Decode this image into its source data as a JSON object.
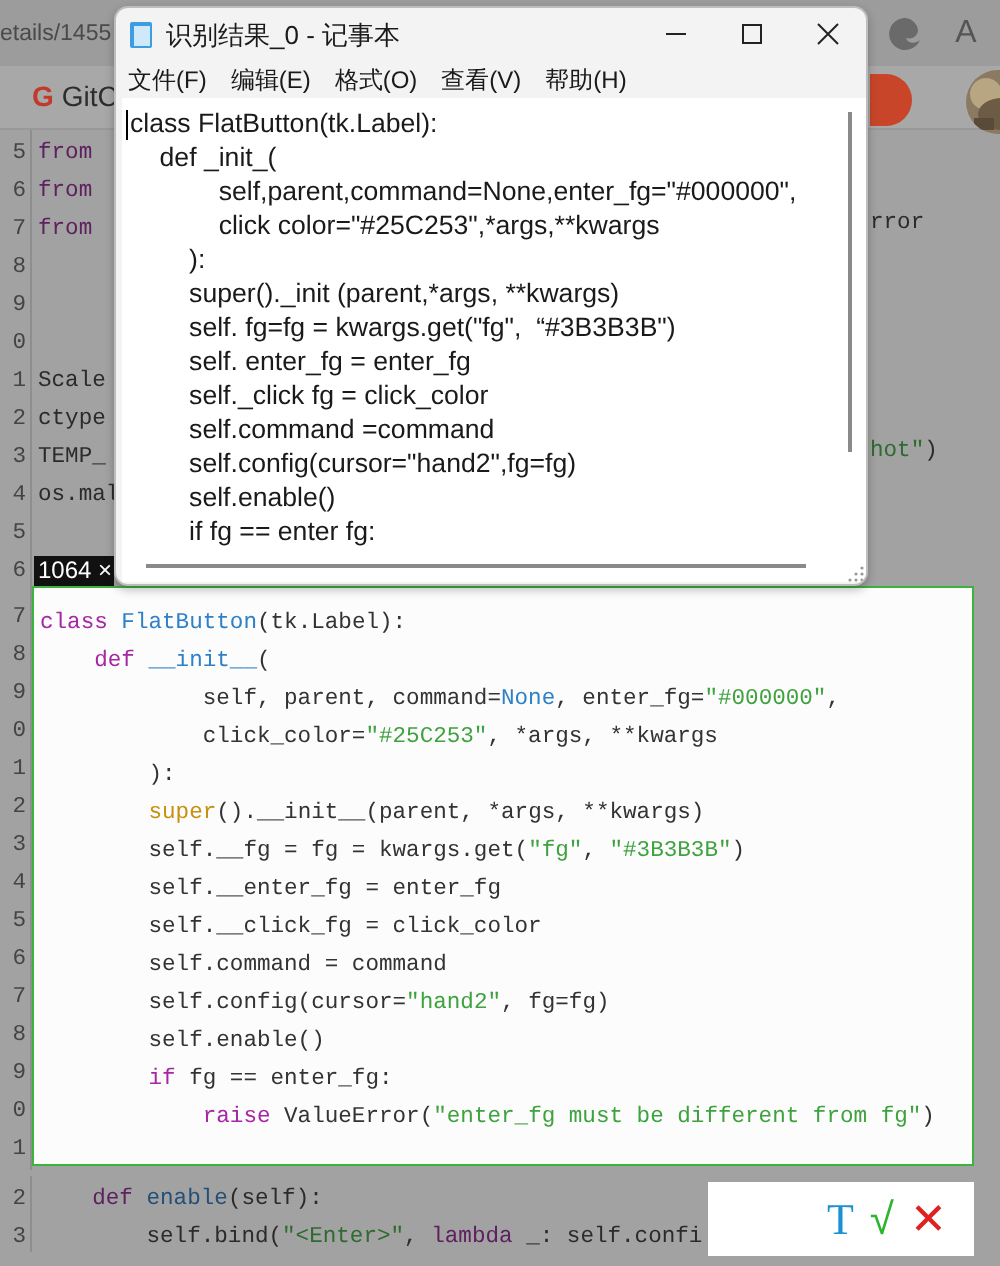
{
  "browser": {
    "address_fragment": "etails/1455",
    "read_aloud_glyph": "A",
    "bookmark": {
      "logo": "G",
      "label": "GitC"
    }
  },
  "editor": {
    "lines": [
      {
        "number": "5",
        "tokens": [
          {
            "kind": "keyword",
            "text": "from"
          }
        ]
      },
      {
        "number": "6",
        "tokens": [
          {
            "kind": "keyword",
            "text": "from"
          }
        ]
      },
      {
        "number": "7",
        "tokens": [
          {
            "kind": "keyword",
            "text": "from"
          }
        ],
        "right": [
          {
            "kind": "plain",
            "text": "rror"
          }
        ]
      },
      {
        "number": "8"
      },
      {
        "number": "9"
      },
      {
        "number": "0"
      },
      {
        "number": "1",
        "tokens": [
          {
            "kind": "plain",
            "text": "Scale"
          }
        ]
      },
      {
        "number": "2",
        "tokens": [
          {
            "kind": "plain",
            "text": "ctype"
          }
        ]
      },
      {
        "number": "3",
        "tokens": [
          {
            "kind": "plain",
            "text": "TEMP_"
          }
        ],
        "right": [
          {
            "kind": "string",
            "text": "hot\""
          },
          {
            "kind": "plain",
            "text": ")"
          }
        ]
      },
      {
        "number": "4",
        "tokens": [
          {
            "kind": "plain",
            "text": "os.mal"
          }
        ]
      },
      {
        "number": "5"
      },
      {
        "number": "6"
      }
    ]
  },
  "selection": {
    "size_label": "1064 ×",
    "lines": [
      {
        "number": "7",
        "tokens": [
          {
            "kind": "keyword",
            "text": "class"
          },
          {
            "kind": "name",
            "text": " FlatButton"
          },
          {
            "kind": "plain",
            "text": "(tk.Label):"
          }
        ]
      },
      {
        "number": "8",
        "tokens": [
          {
            "kind": "keyword",
            "text": "    def"
          },
          {
            "kind": "name",
            "text": " __init__"
          },
          {
            "kind": "plain",
            "text": "("
          }
        ]
      },
      {
        "number": "9",
        "tokens": [
          {
            "kind": "plain",
            "text": "            self, parent, command="
          },
          {
            "kind": "name",
            "text": "None"
          },
          {
            "kind": "plain",
            "text": ", enter_fg="
          },
          {
            "kind": "string",
            "text": "\"#000000\""
          },
          {
            "kind": "plain",
            "text": ","
          }
        ]
      },
      {
        "number": "0",
        "tokens": [
          {
            "kind": "plain",
            "text": "            click_color="
          },
          {
            "kind": "string",
            "text": "\"#25C253\""
          },
          {
            "kind": "plain",
            "text": ", *args, **kwargs"
          }
        ]
      },
      {
        "number": "1",
        "tokens": [
          {
            "kind": "plain",
            "text": "        ):"
          }
        ]
      },
      {
        "number": "2",
        "tokens": [
          {
            "kind": "builtin",
            "text": "        super"
          },
          {
            "kind": "plain",
            "text": "().__init__(parent, *args, **kwargs)"
          }
        ]
      },
      {
        "number": "3",
        "tokens": [
          {
            "kind": "plain",
            "text": "        self.__fg = fg = kwargs.get("
          },
          {
            "kind": "string",
            "text": "\"fg\""
          },
          {
            "kind": "plain",
            "text": ", "
          },
          {
            "kind": "string",
            "text": "\"#3B3B3B\""
          },
          {
            "kind": "plain",
            "text": ")"
          }
        ]
      },
      {
        "number": "4",
        "tokens": [
          {
            "kind": "plain",
            "text": "        self.__enter_fg = enter_fg"
          }
        ]
      },
      {
        "number": "5",
        "tokens": [
          {
            "kind": "plain",
            "text": "        self.__click_fg = click_color"
          }
        ]
      },
      {
        "number": "6",
        "tokens": [
          {
            "kind": "plain",
            "text": "        self.command = command"
          }
        ]
      },
      {
        "number": "7",
        "tokens": [
          {
            "kind": "plain",
            "text": "        self.config(cursor="
          },
          {
            "kind": "string",
            "text": "\"hand2\""
          },
          {
            "kind": "plain",
            "text": ", fg=fg)"
          }
        ]
      },
      {
        "number": "8",
        "tokens": [
          {
            "kind": "plain",
            "text": "        self.enable()"
          }
        ]
      },
      {
        "number": "9",
        "tokens": [
          {
            "kind": "keyword",
            "text": "        if"
          },
          {
            "kind": "plain",
            "text": " fg == enter_fg:"
          }
        ]
      },
      {
        "number": "0",
        "tokens": [
          {
            "kind": "keyword",
            "text": "            raise"
          },
          {
            "kind": "plain",
            "text": " ValueError("
          },
          {
            "kind": "string",
            "text": "\"enter_fg must be different from fg\""
          },
          {
            "kind": "plain",
            "text": ")"
          }
        ]
      },
      {
        "number": "1"
      }
    ]
  },
  "after_lines": [
    {
      "number": "2",
      "tokens": [
        {
          "kind": "keyword",
          "text": "    def"
        },
        {
          "kind": "name",
          "text": " enable"
        },
        {
          "kind": "plain",
          "text": "(self):"
        }
      ]
    },
    {
      "number": "3",
      "tokens": [
        {
          "kind": "plain",
          "text": "        self.bind("
        },
        {
          "kind": "string",
          "text": "\"<Enter>\""
        },
        {
          "kind": "plain",
          "text": ", "
        },
        {
          "kind": "keyword",
          "text": "lambda"
        },
        {
          "kind": "plain",
          "text": " _: self.confi"
        }
      ]
    }
  ],
  "capture_toolbar": {
    "buttons": [
      {
        "kind": "text",
        "label": "T"
      },
      {
        "kind": "confirm",
        "label": "√"
      },
      {
        "kind": "cancel",
        "label": "✕"
      }
    ]
  },
  "notepad": {
    "title": "识别结果_0 - 记事本",
    "menu": [
      "文件(F)",
      "编辑(E)",
      "格式(O)",
      "查看(V)",
      "帮助(H)"
    ],
    "lines": [
      "class FlatButton(tk.Label):",
      "    def _init_(",
      "            self,parent,command=None,enter_fg=\"#000000\",",
      "            click color=\"#25C253\",*args,**kwargs",
      "        ):",
      "        super()._init (parent,*args, **kwargs)",
      "        self. fg=fg = kwargs.get(\"fg\",  “#3B3B3B\")",
      "        self. enter_fg = enter_fg",
      "        self._click fg = click_color",
      "        self.command =command",
      "        self.config(cursor=\"hand2\",fg=fg)",
      "        self.enable()",
      "        if fg == enter fg:"
    ]
  }
}
